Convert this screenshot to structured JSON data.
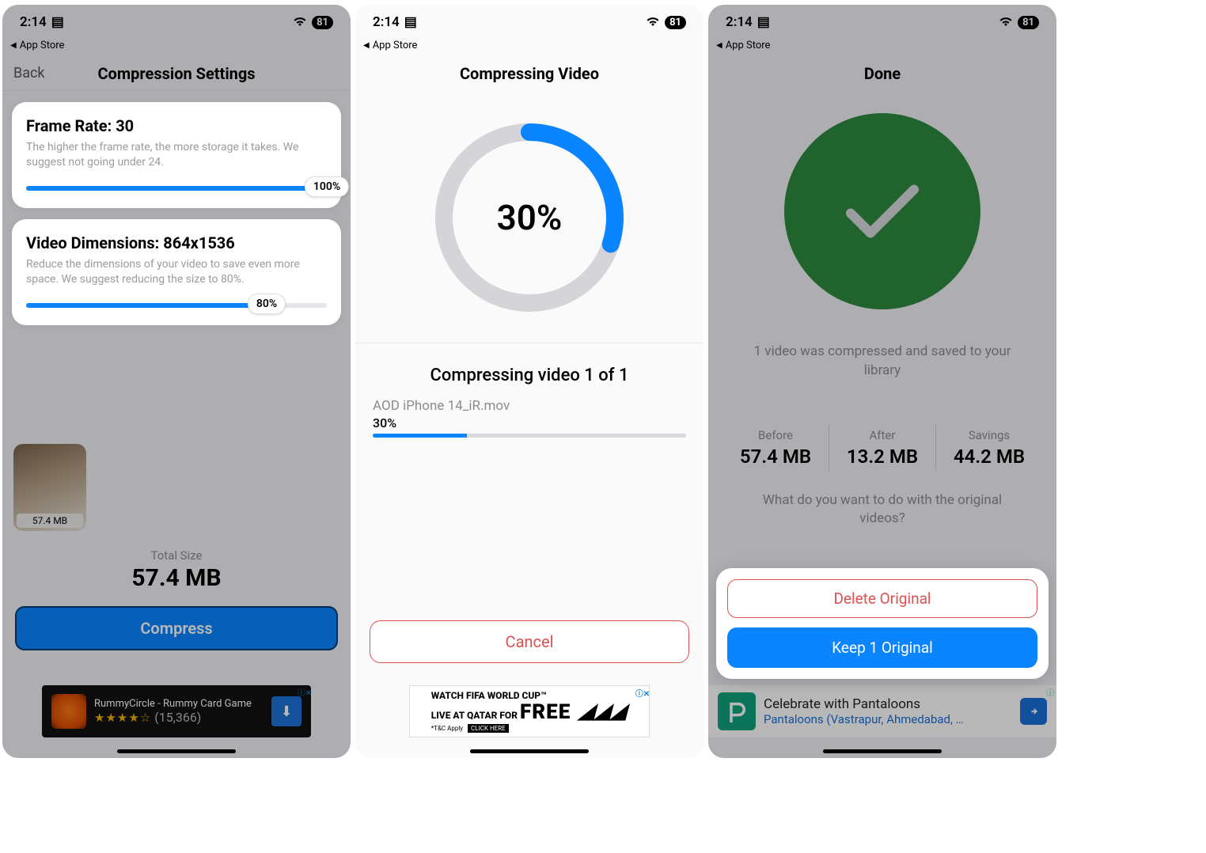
{
  "status": {
    "time": "2:14",
    "battery": "81",
    "breadcrumb": "App Store"
  },
  "screen1": {
    "title": "Compression Settings",
    "back": "Back",
    "frameRate": {
      "heading": "Frame Rate: 30",
      "desc": "The higher the frame rate, the more storage it takes. We suggest not going under 24.",
      "pctLabel": "100%",
      "pct": 100
    },
    "dimensions": {
      "heading": "Video Dimensions: 864x1536",
      "desc": "Reduce the dimensions of your video to save even more space. We suggest reducing the size to 80%.",
      "pctLabel": "80%",
      "pct": 80
    },
    "thumbSize": "57.4 MB",
    "totalLabel": "Total Size",
    "totalValue": "57.4 MB",
    "compressBtn": "Compress",
    "ad": {
      "title": "RummyCircle - Rummy Card Game",
      "reviews": "(15,366)"
    }
  },
  "screen2": {
    "title": "Compressing Video",
    "ringPct": 30,
    "ringPctLabel": "30%",
    "subTitle": "Compressing video 1 of 1",
    "fileName": "AOD iPhone 14_iR.mov",
    "filePctLabel": "30%",
    "filePct": 30,
    "cancel": "Cancel",
    "ad": {
      "line1": "WATCH FIFA WORLD CUP™",
      "line2": "LIVE AT QATAR FOR",
      "free": "FREE",
      "tac": "*T&C Apply",
      "click": "CLICK HERE"
    }
  },
  "screen3": {
    "title": "Done",
    "msg": "1 video was compressed and saved to your library",
    "before": {
      "label": "Before",
      "value": "57.4 MB"
    },
    "after": {
      "label": "After",
      "value": "13.2 MB"
    },
    "savings": {
      "label": "Savings",
      "value": "44.2 MB"
    },
    "question": "What do you want to do with the original videos?",
    "deleteBtn": "Delete Original",
    "keepBtn": "Keep 1 Original",
    "ad": {
      "line1": "Celebrate with Pantaloons",
      "line2": "Pantaloons (Vastrapur, Ahmedabad, …"
    }
  }
}
